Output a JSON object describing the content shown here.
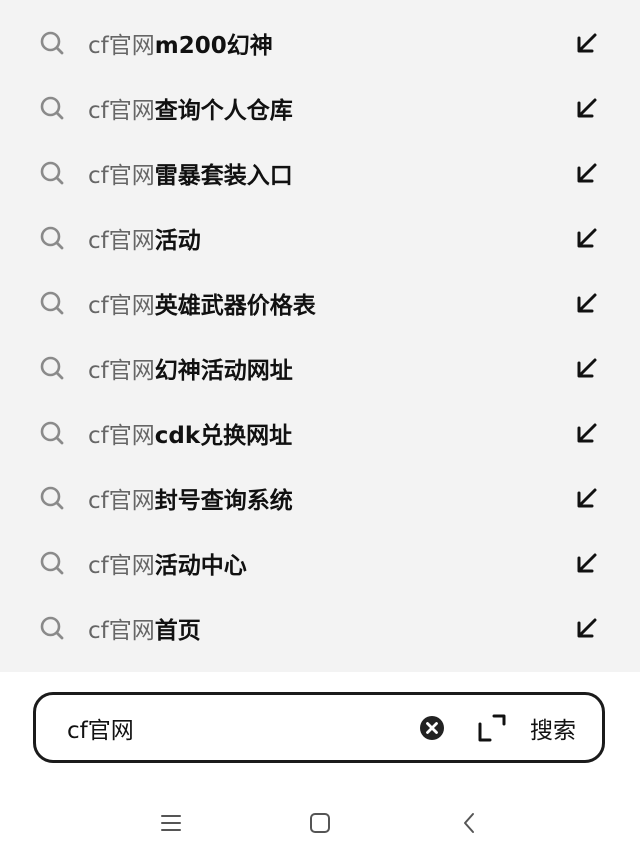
{
  "suggestions": [
    {
      "query": "cf官网",
      "suffix": "m200幻神"
    },
    {
      "query": "cf官网",
      "suffix": "查询个人仓库"
    },
    {
      "query": "cf官网",
      "suffix": "雷暴套装入口"
    },
    {
      "query": "cf官网",
      "suffix": "活动"
    },
    {
      "query": "cf官网",
      "suffix": "英雄武器价格表"
    },
    {
      "query": "cf官网",
      "suffix": "幻神活动网址"
    },
    {
      "query": "cf官网",
      "suffix": "cdk兑换网址"
    },
    {
      "query": "cf官网",
      "suffix": "封号查询系统"
    },
    {
      "query": "cf官网",
      "suffix": "活动中心"
    },
    {
      "query": "cf官网",
      "suffix": "首页"
    }
  ],
  "search": {
    "value": "cf官网",
    "button_label": "搜索"
  },
  "icons": {
    "row_leading": "search-icon",
    "row_trailing": "arrow-up-left-icon",
    "clear": "clear-icon",
    "scan": "scan-icon",
    "nav_menu": "menu-icon",
    "nav_home": "home-icon",
    "nav_back": "back-icon"
  },
  "colors": {
    "list_bg": "#f3f3f3",
    "query_text": "#666666",
    "suggestion_text": "#111111",
    "border": "#1b1b1b"
  }
}
